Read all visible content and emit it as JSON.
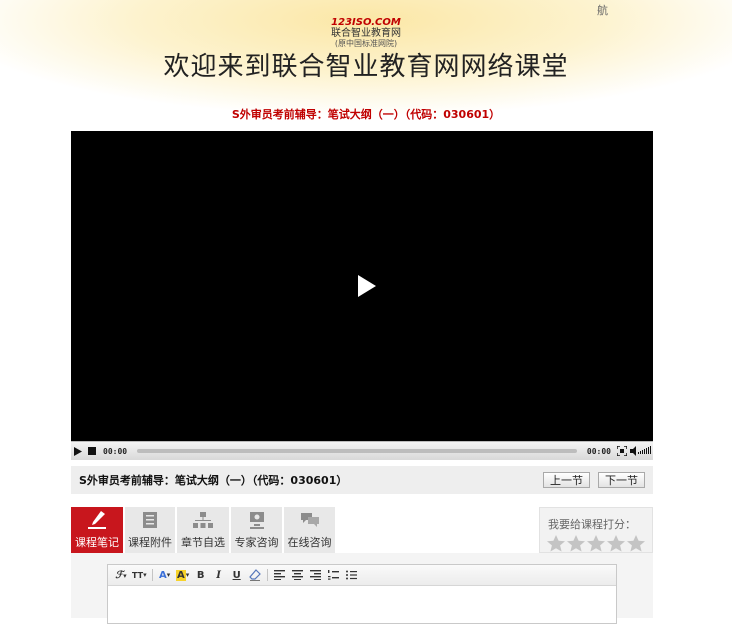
{
  "page": {
    "corner_char": "航",
    "logo": {
      "mark": "123ISO.COM",
      "name": "联合智业教育网",
      "subtitle": "(原中国标准网院)"
    },
    "site_title": "欢迎来到联合智业教育网网络课堂",
    "course_heading": "S外审员考前辅导：笔试大纲（一）（代码：030601）"
  },
  "player": {
    "elapsed": "00:00",
    "duration": "00:00",
    "progress": 0
  },
  "info_bar": {
    "title": "S外审员考前辅导：笔试大纲（一）（代码：030601）",
    "prev_label": "上一节",
    "next_label": "下一节"
  },
  "tabs": [
    {
      "label": "课程笔记",
      "icon": "pen-icon",
      "active": true
    },
    {
      "label": "课程附件",
      "icon": "attachment-icon",
      "active": false
    },
    {
      "label": "章节自选",
      "icon": "chapter-tree-icon",
      "active": false
    },
    {
      "label": "专家咨询",
      "icon": "expert-icon",
      "active": false
    },
    {
      "label": "在线咨询",
      "icon": "chat-icon",
      "active": false
    }
  ],
  "rating": {
    "label": "我要给课程打分：",
    "max": 5,
    "value": 0
  },
  "editor": {
    "toolbar": {
      "font_family": "ℱ",
      "font_size": "TT",
      "font_color": "A",
      "highlight": "A",
      "bold": "B",
      "italic": "I",
      "underline": "U"
    }
  },
  "colors": {
    "accent_red": "#c8161d",
    "heading_red": "#c00000"
  }
}
